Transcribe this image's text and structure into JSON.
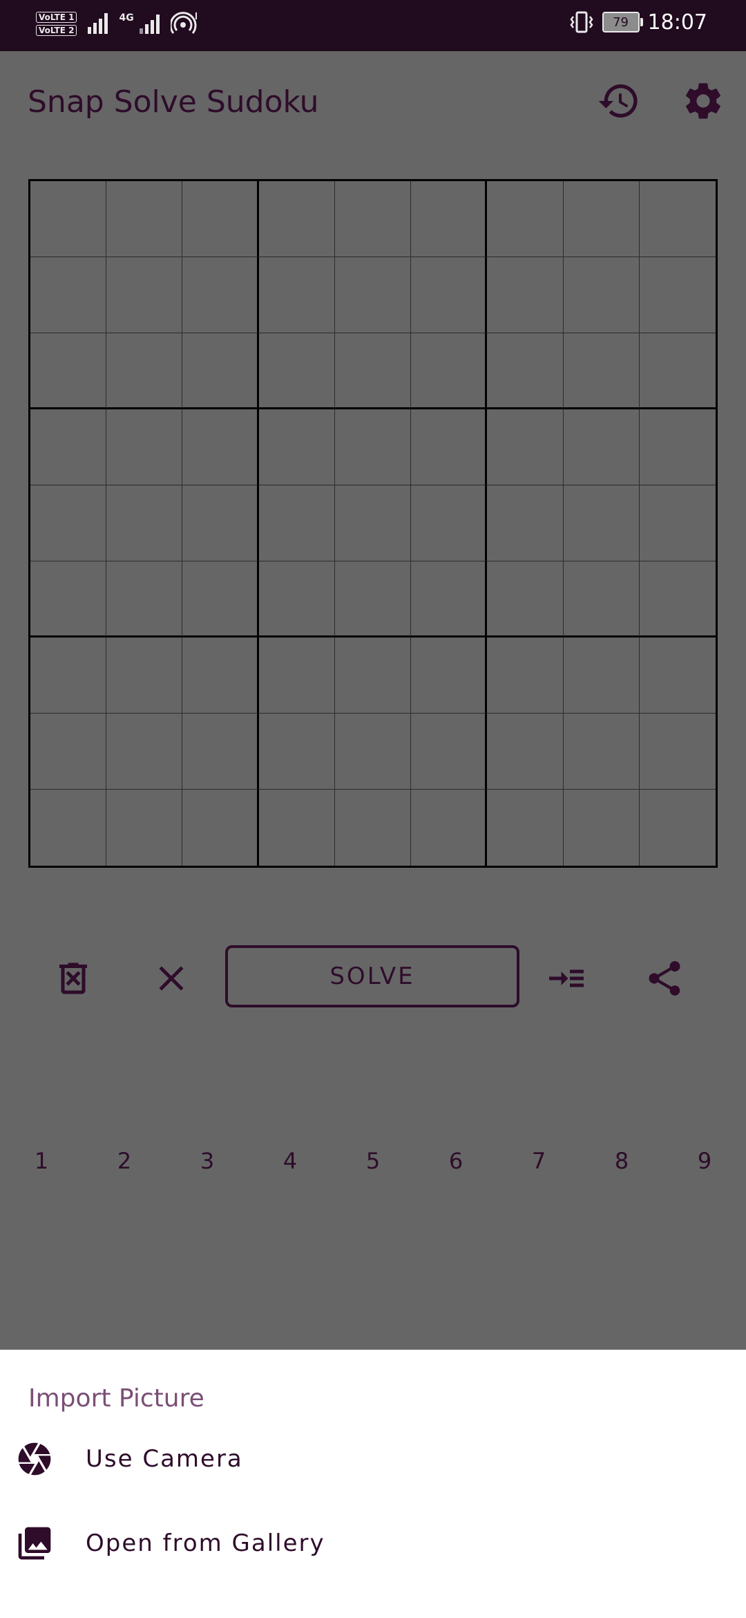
{
  "status_bar": {
    "volte1": "VoLTE 1",
    "volte2": "VoLTE 2",
    "network": "4G",
    "battery": "79",
    "time": "18:07"
  },
  "app_bar": {
    "title": "Snap Solve Sudoku",
    "icons": [
      "history-icon",
      "settings-icon"
    ]
  },
  "controls": {
    "solve_label": "SOLVE",
    "icons": [
      "delete-icon",
      "clear-icon",
      "insert-icon",
      "share-icon"
    ]
  },
  "number_row": [
    "1",
    "2",
    "3",
    "4",
    "5",
    "6",
    "7",
    "8",
    "9"
  ],
  "bottom_sheet": {
    "title": "Import Picture",
    "items": [
      {
        "label": "Use Camera",
        "icon": "camera-icon"
      },
      {
        "label": "Open from Gallery",
        "icon": "gallery-icon"
      }
    ]
  },
  "colors": {
    "status_bar_bg": "#210b1f",
    "scrim": "#666666",
    "primary_text": "#2e0c2a",
    "sheet_title": "#7a4f76",
    "sheet_bg": "#ffffff"
  }
}
